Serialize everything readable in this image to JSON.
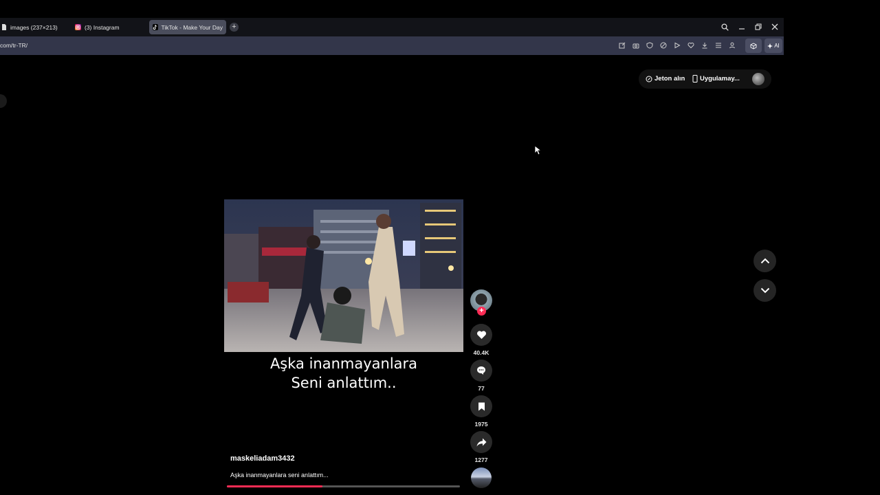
{
  "tabs": [
    {
      "label": "images (237×213)",
      "icon": "file-icon"
    },
    {
      "label": "(3) Instagram",
      "icon": "instagram-icon"
    },
    {
      "label": "TikTok - Make Your Day",
      "icon": "tiktok-icon",
      "active": true
    }
  ],
  "address": {
    "url": "com/tr-TR/"
  },
  "toolbar": {
    "ai_label": "AI"
  },
  "header": {
    "coins_label": "Jeton alın",
    "app_label": "Uygulamay..."
  },
  "video": {
    "caption_line1": "Aşka inanmayanlara",
    "caption_line2": "Seni anlattım..",
    "author": "maskeliadam3432",
    "description": "Aşka inanmayanlara seni anlattım...",
    "progress": 0.41
  },
  "actions": {
    "likes": "40.4K",
    "comments": "77",
    "saves": "1975",
    "shares": "1277"
  },
  "colors": {
    "accent": "#fe2c55",
    "addrbar": "#33364a",
    "tabbar": "#121318"
  }
}
